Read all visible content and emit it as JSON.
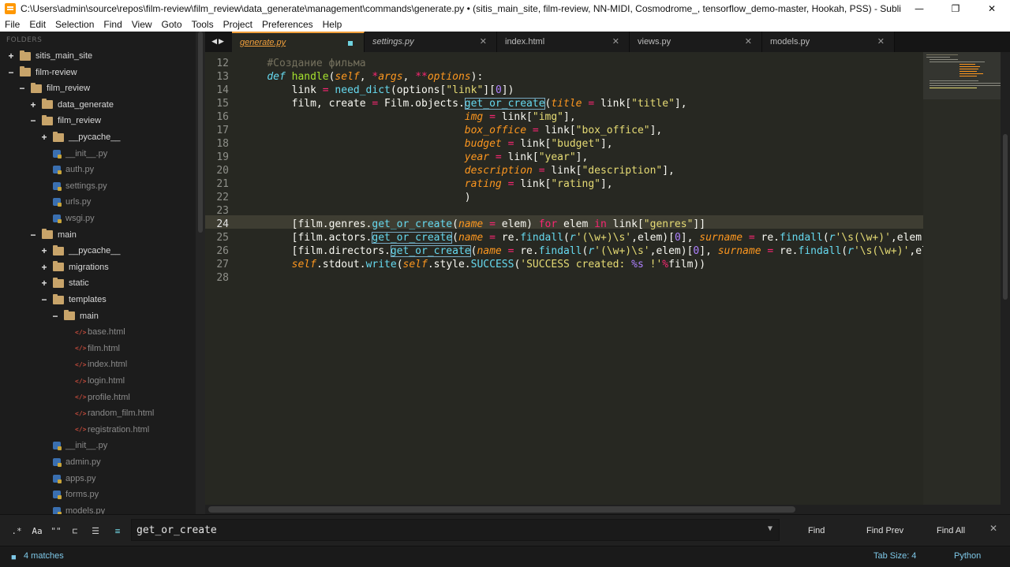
{
  "window": {
    "title": "C:\\Users\\admin\\source\\repos\\film-review\\film_review\\data_generate\\management\\commands\\generate.py • (sitis_main_site, film-review, NN-MIDI, Cosmodrome_, tensorflow_demo-master, Hookah, PSS) - Sublime Text",
    "minimize_icon": "minimize-icon",
    "maximize_icon": "restore-icon",
    "close_icon": "close-icon"
  },
  "menu": [
    "File",
    "Edit",
    "Selection",
    "Find",
    "View",
    "Goto",
    "Tools",
    "Project",
    "Preferences",
    "Help"
  ],
  "sidebar": {
    "header": "FOLDERS",
    "tree": [
      {
        "label": "sitis_main_site",
        "type": "folder",
        "toggle": "+",
        "depth": 0
      },
      {
        "label": "film-review",
        "type": "folder",
        "toggle": "−",
        "depth": 0
      },
      {
        "label": "film_review",
        "type": "folder",
        "toggle": "−",
        "depth": 1
      },
      {
        "label": "data_generate",
        "type": "folder",
        "toggle": "+",
        "depth": 2
      },
      {
        "label": "film_review",
        "type": "folder",
        "toggle": "−",
        "depth": 2
      },
      {
        "label": "__pycache__",
        "type": "folder",
        "toggle": "+",
        "depth": 3
      },
      {
        "label": "__init__.py",
        "type": "py",
        "depth": 3
      },
      {
        "label": "auth.py",
        "type": "py",
        "depth": 3
      },
      {
        "label": "settings.py",
        "type": "py",
        "depth": 3
      },
      {
        "label": "urls.py",
        "type": "py",
        "depth": 3
      },
      {
        "label": "wsgi.py",
        "type": "py",
        "depth": 3
      },
      {
        "label": "main",
        "type": "folder",
        "toggle": "−",
        "depth": 2
      },
      {
        "label": "__pycache__",
        "type": "folder",
        "toggle": "+",
        "depth": 3
      },
      {
        "label": "migrations",
        "type": "folder",
        "toggle": "+",
        "depth": 3
      },
      {
        "label": "static",
        "type": "folder",
        "toggle": "+",
        "depth": 3
      },
      {
        "label": "templates",
        "type": "folder",
        "toggle": "−",
        "depth": 3
      },
      {
        "label": "main",
        "type": "folder",
        "toggle": "−",
        "depth": 4
      },
      {
        "label": "base.html",
        "type": "html",
        "depth": 5
      },
      {
        "label": "film.html",
        "type": "html",
        "depth": 5
      },
      {
        "label": "index.html",
        "type": "html",
        "depth": 5
      },
      {
        "label": "login.html",
        "type": "html",
        "depth": 5
      },
      {
        "label": "profile.html",
        "type": "html",
        "depth": 5
      },
      {
        "label": "random_film.html",
        "type": "html",
        "depth": 5
      },
      {
        "label": "registration.html",
        "type": "html",
        "depth": 5
      },
      {
        "label": "__init__.py",
        "type": "py",
        "depth": 3
      },
      {
        "label": "admin.py",
        "type": "py",
        "depth": 3
      },
      {
        "label": "apps.py",
        "type": "py",
        "depth": 3
      },
      {
        "label": "forms.py",
        "type": "py",
        "depth": 3
      },
      {
        "label": "models.py",
        "type": "py",
        "depth": 3
      }
    ]
  },
  "tabs": [
    {
      "label": "generate.py",
      "active": true,
      "dirty": true
    },
    {
      "label": "settings.py",
      "active": false
    },
    {
      "label": "index.html",
      "active": false
    },
    {
      "label": "views.py",
      "active": false
    },
    {
      "label": "models.py",
      "active": false
    }
  ],
  "editor": {
    "line_numbers": [
      "12",
      "13",
      "14",
      "15",
      "16",
      "17",
      "18",
      "19",
      "20",
      "21",
      "22",
      "23",
      "24",
      "25",
      "26",
      "27",
      "28"
    ],
    "current_line": "24",
    "code": {
      "l12_comment": "#Создание фильма",
      "l13_def": "def",
      "l13_fn": "handle",
      "l13_self": "self",
      "l13_args": "args",
      "l13_options": "options",
      "l14_a": "link",
      "l14_fn": "need_dict",
      "l14_b": "options[",
      "l14_str": "\"link\"",
      "l14_num": "0",
      "l15_a": "film, create",
      "l15_b": "Film.objects.",
      "l15_fn": "get_or_create",
      "l15_par": "title",
      "l15_c": "link[",
      "l15_str": "\"title\"",
      "l16_par": "img",
      "l16_str": "\"img\"",
      "l17_par": "box_office",
      "l17_str": "\"box_office\"",
      "l18_par": "budget",
      "l18_str": "\"budget\"",
      "l19_par": "year",
      "l19_str": "\"year\"",
      "l20_par": "description",
      "l20_str": "\"description\"",
      "l21_par": "rating",
      "l21_str": "\"rating\"",
      "l22": ")",
      "l24_a": "[film.genres.",
      "l24_fn": "get_or_create",
      "l24_par": "name",
      "l24_b": "elem",
      "l24_for": "for",
      "l24_c": "elem",
      "l24_in": "in",
      "l24_d": "link[",
      "l24_str": "\"genres\"",
      "l25_a": "[film.actors.",
      "l25_fn": "get_or_create",
      "l25_par": "name",
      "l25_b": "re.",
      "l25_fn2": "findall",
      "l25_r": "r",
      "l25_str": "'(\\w+)\\s'",
      "l25_c": ",elem)[",
      "l25_num": "0",
      "l25_par2": "surname",
      "l25_d": "re.",
      "l25_fn3": "findall",
      "l25_r2": "r",
      "l25_str2": "'\\s(\\w+)'",
      "l25_e": ",elem)",
      "l26_a": "[film.directors.",
      "l26_fn": "get_or_create",
      "l26_par": "name",
      "l26_b": "re.",
      "l26_fn2": "findall",
      "l26_r": "r",
      "l26_str": "'(\\w+)\\s'",
      "l26_c": ",elem)[",
      "l26_num": "0",
      "l26_par2": "surname",
      "l26_d": "re.",
      "l26_fn3": "findall",
      "l26_r2": "r",
      "l26_str2": "'\\s(\\w+)'",
      "l26_e": ",ele",
      "l27_self": "self",
      "l27_a": ".stdout.",
      "l27_fn": "write",
      "l27_self2": "self",
      "l27_b": ".style.",
      "l27_cls": "SUCCESS",
      "l27_str": "'SUCCESS created: ",
      "l27_fmt": "%s",
      "l27_str2": " !'",
      "l27_op": "%",
      "l27_c": "film))"
    }
  },
  "find": {
    "query": "get_or_create",
    "options": [
      {
        "icon": "regex-icon",
        "glyph": ".*"
      },
      {
        "icon": "case-sensitive-icon",
        "glyph": "Aa"
      },
      {
        "icon": "whole-word-icon",
        "glyph": "\"\""
      },
      {
        "icon": "wrap-icon",
        "glyph": "⊏"
      },
      {
        "icon": "in-selection-icon",
        "glyph": "☰"
      },
      {
        "icon": "highlight-matches-icon",
        "glyph": "≡"
      }
    ],
    "find_label": "Find",
    "find_prev_label": "Find Prev",
    "find_all_label": "Find All",
    "close_glyph": "✕"
  },
  "status": {
    "matches": "4 matches",
    "tab_size": "Tab Size: 4",
    "syntax": "Python"
  },
  "colors": {
    "accent": "#f2a03c",
    "editor_bg": "#272822",
    "status_text": "#7ec8e8"
  }
}
